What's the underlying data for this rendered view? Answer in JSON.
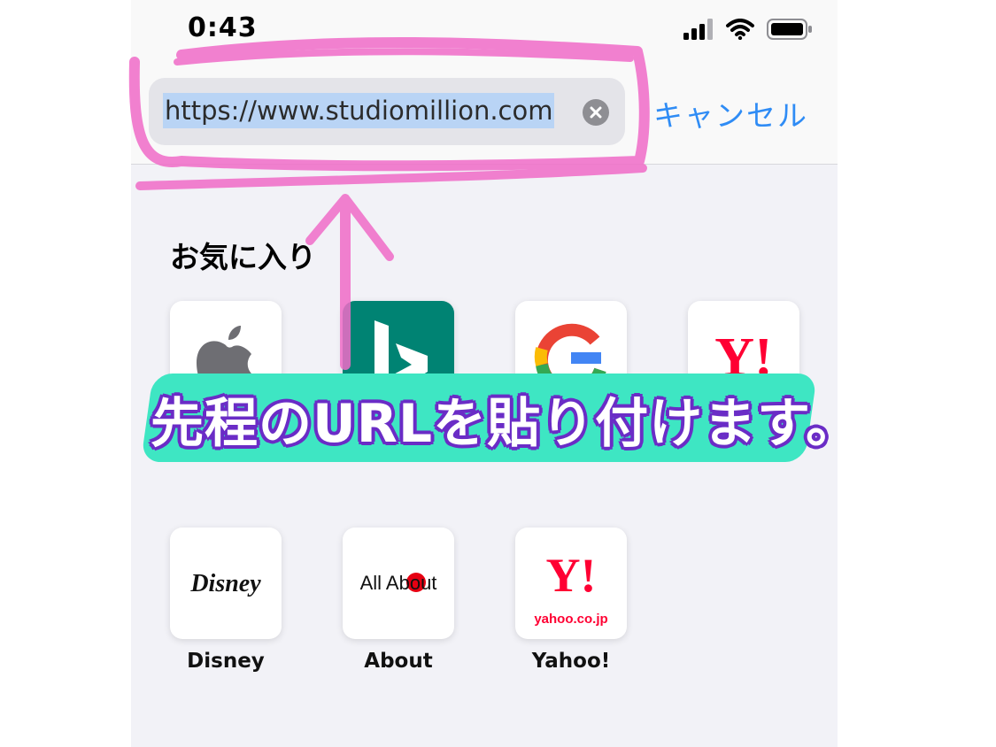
{
  "status_bar": {
    "time": "0:43",
    "icons": [
      "cellular-signal-icon",
      "wifi-icon",
      "battery-icon"
    ]
  },
  "address_bar": {
    "url_value": "https://www.studiomillion.com",
    "clear_icon": "clear-icon",
    "cancel_label": "キャンセル"
  },
  "favorites": {
    "heading": "お気に入り",
    "items": [
      {
        "label": "",
        "icon": "apple-logo-icon"
      },
      {
        "label": "",
        "icon": "bing-logo-icon"
      },
      {
        "label": "",
        "icon": "google-logo-icon"
      },
      {
        "label": "",
        "icon": "yahoo-logo-icon",
        "logo_text": "Y!"
      },
      {
        "label": "Disney",
        "icon": "disney-logo-icon",
        "logo_text": "Disney"
      },
      {
        "label": "About",
        "icon": "allabout-logo-icon",
        "logo_text": "All About"
      },
      {
        "label": "Yahoo!",
        "icon": "yahoo-logo-icon",
        "logo_text": "Y!",
        "sub_text": "yahoo.co.jp"
      }
    ]
  },
  "annotation": {
    "caption": "先程のURLを貼り付けます。",
    "highlight_color": "#f06cc8",
    "caption_outline_color": "#6a2cc6",
    "caption_shadow_color": "#3ee6c3"
  },
  "colors": {
    "accent": "#2f8cf5",
    "selection": "#b9d4f5",
    "yahoo_red": "#ff0033",
    "bing_teal": "#008373"
  }
}
